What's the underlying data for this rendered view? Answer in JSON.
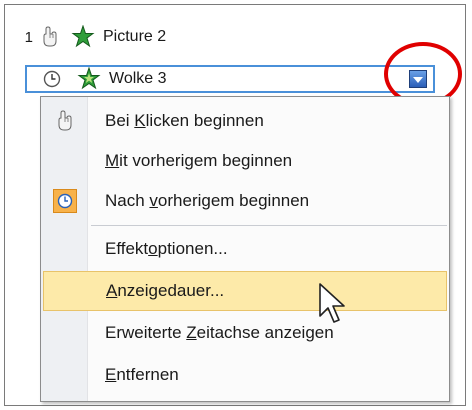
{
  "list": {
    "row1": {
      "number": "1",
      "label": "Picture 2"
    },
    "row2": {
      "label": "Wolke 3"
    }
  },
  "menu": {
    "items": [
      {
        "pre": "Bei ",
        "ul": "K",
        "post": "licken beginnen"
      },
      {
        "pre": "",
        "ul": "M",
        "post": "it vorherigem beginnen"
      },
      {
        "pre": "Nach ",
        "ul": "v",
        "post": "orherigem beginnen"
      },
      {
        "pre": "Effekt",
        "ul": "o",
        "post": "ptionen..."
      },
      {
        "pre": "",
        "ul": "A",
        "post": "nzeigedauer..."
      },
      {
        "pre": "Erweiterte ",
        "ul": "Z",
        "post": "eitachse anzeigen"
      },
      {
        "pre": "",
        "ul": "E",
        "post": "ntfernen"
      }
    ]
  },
  "icons": {
    "mouse": "mouse-icon",
    "clock": "clock-icon",
    "star": "star-effect-icon",
    "dropdown": "chevron-down-icon"
  },
  "colors": {
    "highlight": "#fdeaa9",
    "selection_border": "#4a90d9",
    "annotation": "#e00000",
    "checked_bg": "#f8b24a"
  }
}
